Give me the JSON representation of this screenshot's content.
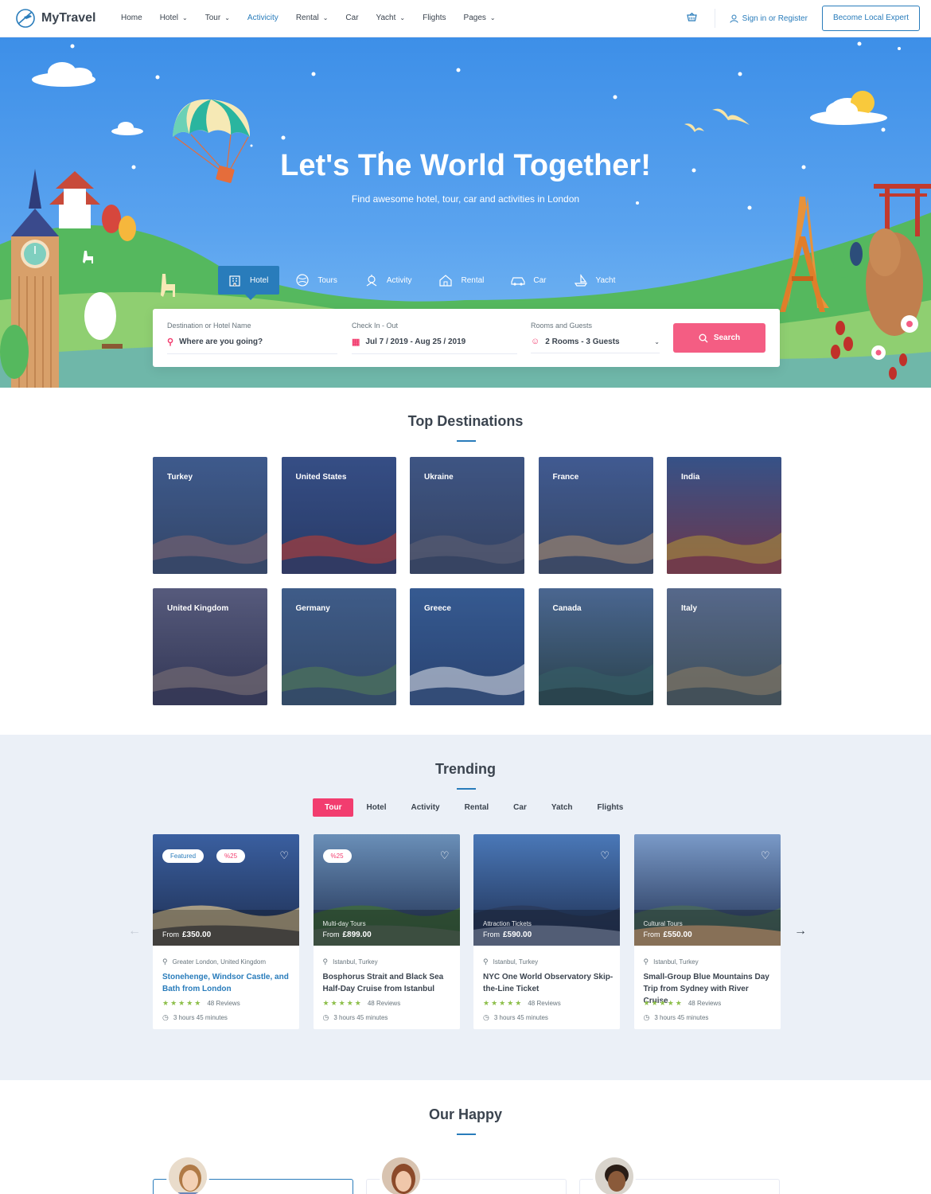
{
  "nav": {
    "brand": "MyTravel",
    "menu": [
      {
        "label": "Home",
        "dropdown": false,
        "active": false
      },
      {
        "label": "Hotel",
        "dropdown": true,
        "active": false
      },
      {
        "label": "Tour",
        "dropdown": true,
        "active": false
      },
      {
        "label": "Activicity",
        "dropdown": false,
        "active": true
      },
      {
        "label": "Rental",
        "dropdown": true,
        "active": false
      },
      {
        "label": "Car",
        "dropdown": false,
        "active": false
      },
      {
        "label": "Yacht",
        "dropdown": true,
        "active": false
      },
      {
        "label": "Flights",
        "dropdown": false,
        "active": false
      },
      {
        "label": "Pages",
        "dropdown": true,
        "active": false
      }
    ],
    "signin": "Sign in or Register",
    "expert": "Become Local Expert"
  },
  "hero": {
    "title": "Let's The World Together!",
    "subtitle": "Find awesome hotel, tour, car and activities in London",
    "tabs": [
      "Hotel",
      "Tours",
      "Activity",
      "Rental",
      "Car",
      "Yacht"
    ],
    "active_tab": "Hotel",
    "fields": {
      "destination_label": "Destination or Hotel Name",
      "destination_value": "Where are you going?",
      "dates_label": "Check In - Out",
      "dates_value": "Jul 7 / 2019 - Aug 25 / 2019",
      "guests_label": "Rooms and Guests",
      "guests_value": "2 Rooms - 3 Guests"
    },
    "search_label": "Search"
  },
  "destinations": {
    "title": "Top Destinations",
    "items": [
      "Turkey",
      "United States",
      "Ukraine",
      "France",
      "India",
      "United Kingdom",
      "Germany",
      "Greece",
      "Canada",
      "Italy"
    ]
  },
  "trending": {
    "title": "Trending",
    "tabs": [
      "Tour",
      "Hotel",
      "Activity",
      "Rental",
      "Car",
      "Yatch",
      "Flights"
    ],
    "active_tab": "Tour",
    "cards": [
      {
        "featured": "Featured",
        "discount": "%25",
        "category": "",
        "from": "From",
        "price": "£350.00",
        "location": "Greater London, United Kingdom",
        "title": "Stonehenge, Windsor Castle, and Bath from London",
        "highlight": true,
        "stars": "★★★★★",
        "reviews": "48 Reviews",
        "duration": "3 hours 45 minutes"
      },
      {
        "featured": "",
        "discount": "%25",
        "category": "Multi-day Tours",
        "from": "From",
        "price": "£899.00",
        "location": "Istanbul, Turkey",
        "title": "Bosphorus Strait and Black Sea Half-Day Cruise from Istanbul",
        "highlight": false,
        "stars": "★★★★★",
        "reviews": "48 Reviews",
        "duration": "3 hours 45 minutes"
      },
      {
        "featured": "",
        "discount": "",
        "category": "Attraction Tickets",
        "from": "From",
        "price": "£590.00",
        "location": "Istanbul, Turkey",
        "title": "NYC One World Observatory Skip-the-Line Ticket",
        "highlight": false,
        "stars": "★★★★★",
        "reviews": "48 Reviews",
        "duration": "3 hours 45 minutes"
      },
      {
        "featured": "",
        "discount": "",
        "category": "Cultural Tours",
        "from": "From",
        "price": "£550.00",
        "location": "Istanbul, Turkey",
        "title": "Small-Group Blue Mountains Day Trip from Sydney with River Cruise",
        "highlight": false,
        "stars": "★★★★★",
        "reviews": "48 Reviews",
        "duration": "3 hours 45 minutes"
      }
    ]
  },
  "happy": {
    "title": "Our Happy"
  },
  "colors": {
    "primary": "#297cbb",
    "accent": "#f23d6f",
    "star": "#8dbf4a",
    "trend_bg": "#ebf0f7"
  }
}
